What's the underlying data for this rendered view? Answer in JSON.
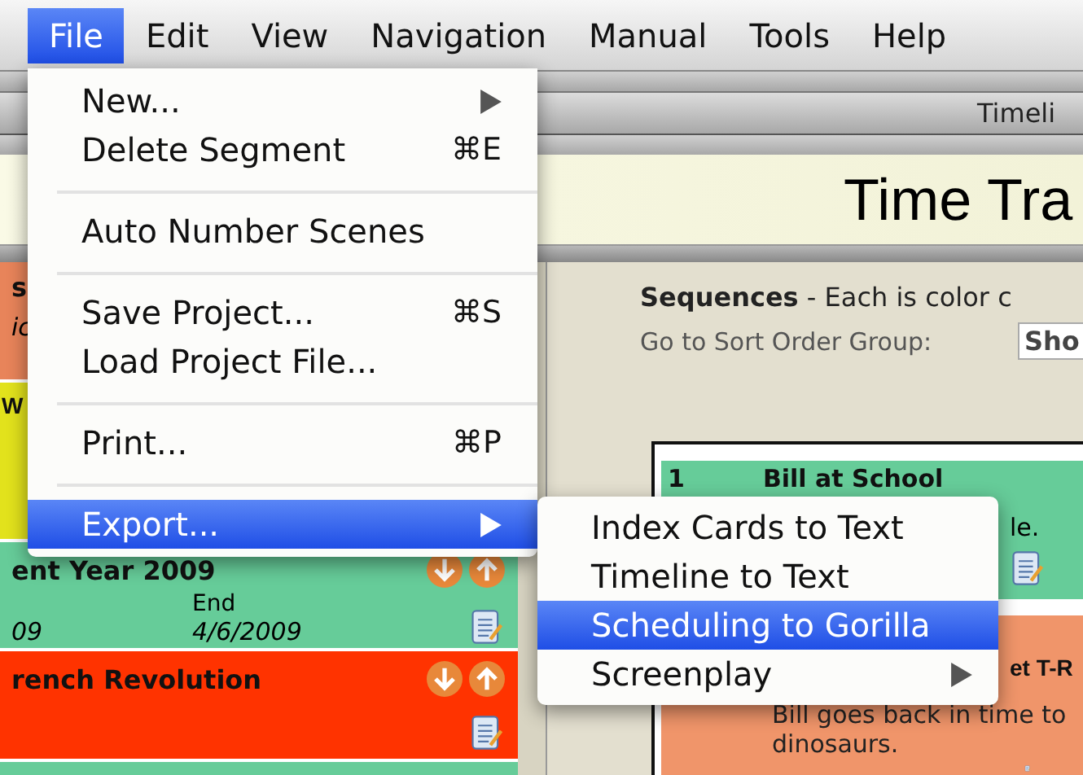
{
  "menu_bar": {
    "items": [
      {
        "label": "File",
        "selected": true
      },
      {
        "label": "Edit",
        "selected": false
      },
      {
        "label": "View",
        "selected": false
      },
      {
        "label": "Navigation",
        "selected": false
      },
      {
        "label": "Manual",
        "selected": false
      },
      {
        "label": "Tools",
        "selected": false
      },
      {
        "label": "Help",
        "selected": false
      }
    ]
  },
  "file_menu": {
    "items": [
      {
        "kind": "item",
        "label": "New...",
        "submenu": true,
        "selected": false
      },
      {
        "kind": "item",
        "label": "Delete Segment",
        "shortcut": "⌘E",
        "submenu": false,
        "selected": false
      },
      {
        "kind": "separator"
      },
      {
        "kind": "item",
        "label": "Auto Number Scenes",
        "submenu": false,
        "selected": false
      },
      {
        "kind": "separator"
      },
      {
        "kind": "item",
        "label": "Save Project...",
        "shortcut": "⌘S",
        "submenu": false,
        "selected": false
      },
      {
        "kind": "item",
        "label": "Load Project File...",
        "submenu": false,
        "selected": false
      },
      {
        "kind": "separator"
      },
      {
        "kind": "item",
        "label": "Print...",
        "shortcut": "⌘P",
        "submenu": false,
        "selected": false
      },
      {
        "kind": "separator"
      },
      {
        "kind": "item",
        "label": "Export...",
        "submenu": true,
        "selected": true
      }
    ]
  },
  "export_submenu": {
    "items": [
      {
        "label": "Index Cards to Text",
        "submenu": false,
        "selected": false
      },
      {
        "label": "Timeline to Text",
        "submenu": false,
        "selected": false
      },
      {
        "label": "Scheduling to Gorilla",
        "submenu": false,
        "selected": true
      },
      {
        "label": "Screenplay",
        "submenu": true,
        "selected": false
      }
    ]
  },
  "window": {
    "title": "Timeli"
  },
  "header": {
    "title": "Time Tra"
  },
  "left_panel": {
    "cards": [
      {
        "color": "#e8845a",
        "title": "s",
        "text": "ic"
      },
      {
        "color": "#e2e21c",
        "title": "W"
      },
      {
        "color": "#66cc99",
        "title": "ent Year 2009",
        "end_label": "End",
        "start": "09",
        "end": "4/6/2009"
      },
      {
        "color": "#ff3300",
        "title": "rench Revolution"
      },
      {
        "color": "#66cc99"
      }
    ]
  },
  "sequences": {
    "text": "**Sequences** - Each is color c"
  },
  "sort_group": {
    "label": "Go to Sort Order Group:",
    "value": "Sho"
  },
  "sequence_cards": [
    {
      "color": "#66cc99",
      "number": "1",
      "title": "Bill at School",
      "text": "le."
    },
    {
      "color": "#f0956a",
      "title": "et T-R",
      "text": "Bill goes back in time to dinosaurs."
    }
  ]
}
